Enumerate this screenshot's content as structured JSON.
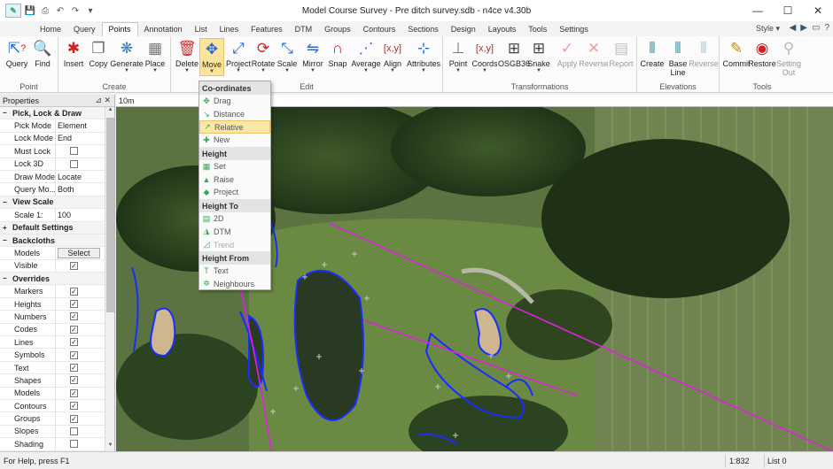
{
  "window": {
    "title": "Model Course Survey - Pre ditch survey.sdb - n4ce v4.30b",
    "minimize": "—",
    "maximize": "☐",
    "close": "✕"
  },
  "tabs": [
    "Home",
    "Query",
    "Points",
    "Annotation",
    "List",
    "Lines",
    "Features",
    "DTM",
    "Groups",
    "Contours",
    "Sections",
    "Design",
    "Layouts",
    "Tools",
    "Settings"
  ],
  "active_tab": "Points",
  "style_label": "Style",
  "ribbon": {
    "groups": {
      "point": "Point",
      "create": "Create",
      "edit": "Edit",
      "transformations": "Transformations",
      "elevations": "Elevations",
      "tools": "Tools"
    },
    "buttons": {
      "query": "Query",
      "find": "Find",
      "insert": "Insert",
      "copy": "Copy",
      "generate": "Generate",
      "place": "Place",
      "delete": "Delete",
      "move": "Move",
      "project": "Project",
      "rotate": "Rotate",
      "scale": "Scale",
      "mirror": "Mirror",
      "snap": "Snap",
      "average": "Average",
      "align": "Align",
      "attributes": "Attributes",
      "point": "Point",
      "coords": "Coords",
      "osgb36": "OSGB36",
      "snake": "Snake",
      "apply": "Apply",
      "reverse": "Reverse",
      "report": "Report",
      "create": "Create",
      "base_line_1": "Base",
      "base_line_2": "Line",
      "reverse2": "Reverse",
      "commit": "Commit",
      "restore": "Restore",
      "setting_out_1": "Setting",
      "setting_out_2": "Out"
    }
  },
  "properties": {
    "title": "Properties",
    "pin": "📌",
    "close": "✕",
    "rows": [
      {
        "type": "section",
        "label": "Pick, Lock & Draw",
        "toggle": "−"
      },
      {
        "type": "dropdown",
        "label": "Pick Mode",
        "value": "Element"
      },
      {
        "type": "dropdown",
        "label": "Lock Mode",
        "value": "End"
      },
      {
        "type": "check",
        "label": "Must Lock",
        "checked": false
      },
      {
        "type": "check",
        "label": "Lock 3D",
        "checked": false
      },
      {
        "type": "dropdown",
        "label": "Draw Mode",
        "value": "Locate"
      },
      {
        "type": "dropdown",
        "label": "Query Mo...",
        "value": "Both"
      },
      {
        "type": "section",
        "label": "View Scale",
        "toggle": "−"
      },
      {
        "type": "dropdown",
        "label": "Scale 1:",
        "value": "100"
      },
      {
        "type": "section",
        "label": "Default Settings",
        "toggle": "+"
      },
      {
        "type": "section",
        "label": "Backcloths",
        "toggle": "−"
      },
      {
        "type": "button",
        "label": "Models",
        "value": "Select"
      },
      {
        "type": "check",
        "label": "Visible",
        "checked": true
      },
      {
        "type": "section",
        "label": "Overrides",
        "toggle": "−"
      },
      {
        "type": "check",
        "label": "Markers",
        "checked": true
      },
      {
        "type": "check",
        "label": "Heights",
        "checked": true
      },
      {
        "type": "check",
        "label": "Numbers",
        "checked": true
      },
      {
        "type": "check",
        "label": "Codes",
        "checked": true
      },
      {
        "type": "check",
        "label": "Lines",
        "checked": true
      },
      {
        "type": "check",
        "label": "Symbols",
        "checked": true
      },
      {
        "type": "check",
        "label": "Text",
        "checked": true
      },
      {
        "type": "check",
        "label": "Shapes",
        "checked": true
      },
      {
        "type": "check",
        "label": "Models",
        "checked": true
      },
      {
        "type": "check",
        "label": "Contours",
        "checked": true
      },
      {
        "type": "check",
        "label": "Groups",
        "checked": true
      },
      {
        "type": "check",
        "label": "Slopes",
        "checked": false
      },
      {
        "type": "check",
        "label": "Shading",
        "checked": false
      }
    ]
  },
  "scale_label": "10m",
  "move_menu": {
    "sections": [
      {
        "header": "Co-ordinates",
        "items": [
          {
            "label": "Drag",
            "icon": "✥",
            "state": "normal"
          },
          {
            "label": "Distance",
            "icon": "↘",
            "state": "normal"
          },
          {
            "label": "Relative",
            "icon": "↗",
            "state": "highlighted"
          },
          {
            "label": "New",
            "icon": "✚",
            "state": "normal"
          }
        ]
      },
      {
        "header": "Height",
        "items": [
          {
            "label": "Set",
            "icon": "▦",
            "state": "normal"
          },
          {
            "label": "Raise",
            "icon": "▲",
            "state": "normal"
          },
          {
            "label": "Project",
            "icon": "◆",
            "state": "normal"
          }
        ]
      },
      {
        "header": "Height To",
        "items": [
          {
            "label": "2D",
            "icon": "▤",
            "state": "normal"
          },
          {
            "label": "DTM",
            "icon": "◮",
            "state": "normal"
          },
          {
            "label": "Trend",
            "icon": "◿",
            "state": "disabled"
          }
        ]
      },
      {
        "header": "Height From",
        "items": [
          {
            "label": "Text",
            "icon": "T",
            "state": "normal"
          },
          {
            "label": "Neighbours",
            "icon": "✲",
            "state": "normal"
          }
        ]
      }
    ]
  },
  "status": {
    "help": "For Help, press F1",
    "scale": "1:832",
    "list": "List 0"
  },
  "colors": {
    "accent": "#fde49a",
    "survey_lines_blue": "#1a2cff",
    "ditch_line_magenta": "#e020e0",
    "ground_green": "#4f6a3a"
  }
}
